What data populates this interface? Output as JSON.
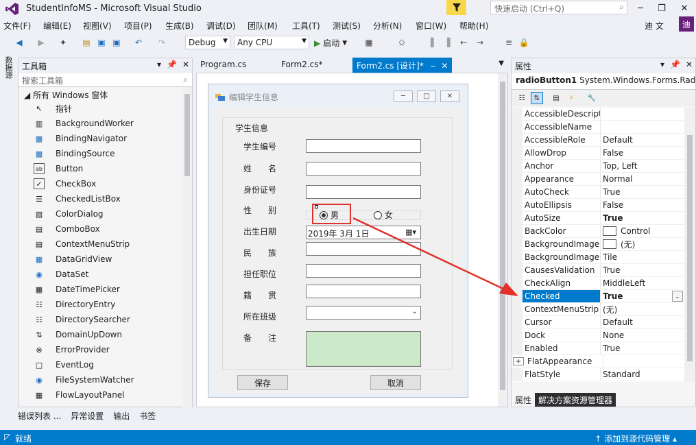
{
  "title": "StudentInfoMS - Microsoft Visual Studio",
  "quick_launch_placeholder": "快速启动 (Ctrl+Q)",
  "menu": [
    "文件(F)",
    "编辑(E)",
    "视图(V)",
    "项目(P)",
    "生成(B)",
    "调试(D)",
    "团队(M)",
    "工具(T)",
    "测试(S)",
    "分析(N)",
    "窗口(W)",
    "帮助(H)"
  ],
  "user": {
    "name": "迪 文",
    "initial": "迪"
  },
  "toolbar": {
    "config": "Debug",
    "platform": "Any CPU",
    "start": "启动"
  },
  "left_strip_tab": "数据源",
  "toolbox": {
    "title": "工具箱",
    "search_placeholder": "搜索工具箱",
    "group": "所有 Windows 窗体",
    "items": [
      {
        "label": "指针",
        "icon": "pointer-icon"
      },
      {
        "label": "BackgroundWorker",
        "icon": "backgroundworker-icon"
      },
      {
        "label": "BindingNavigator",
        "icon": "bindingnavigator-icon"
      },
      {
        "label": "BindingSource",
        "icon": "bindingsource-icon"
      },
      {
        "label": "Button",
        "icon": "button-icon"
      },
      {
        "label": "CheckBox",
        "icon": "checkbox-icon"
      },
      {
        "label": "CheckedListBox",
        "icon": "checkedlistbox-icon"
      },
      {
        "label": "ColorDialog",
        "icon": "colordialog-icon"
      },
      {
        "label": "ComboBox",
        "icon": "combobox-icon"
      },
      {
        "label": "ContextMenuStrip",
        "icon": "contextmenustrip-icon"
      },
      {
        "label": "DataGridView",
        "icon": "datagridview-icon"
      },
      {
        "label": "DataSet",
        "icon": "dataset-icon"
      },
      {
        "label": "DateTimePicker",
        "icon": "datetimepicker-icon"
      },
      {
        "label": "DirectoryEntry",
        "icon": "directoryentry-icon"
      },
      {
        "label": "DirectorySearcher",
        "icon": "directorysearcher-icon"
      },
      {
        "label": "DomainUpDown",
        "icon": "domainupdown-icon"
      },
      {
        "label": "ErrorProvider",
        "icon": "errorprovider-icon"
      },
      {
        "label": "EventLog",
        "icon": "eventlog-icon"
      },
      {
        "label": "FileSystemWatcher",
        "icon": "filesystemwatcher-icon"
      },
      {
        "label": "FlowLayoutPanel",
        "icon": "flowlayoutpanel-icon"
      }
    ]
  },
  "bottom_tabs": [
    "错误列表 ...",
    "异常设置",
    "输出",
    "书签"
  ],
  "status": {
    "left": "就绪",
    "right": "↑ 添加到源代码管理 ▴"
  },
  "doc_tabs": [
    {
      "label": "Program.cs",
      "active": false
    },
    {
      "label": "Form2.cs*",
      "active": false
    },
    {
      "label": "Form2.cs [设计]*",
      "active": true
    }
  ],
  "form": {
    "title": "编辑学生信息",
    "group_title": "学生信息",
    "labels": [
      "学生编号",
      "姓　　名",
      "身份证号",
      "性　　别",
      "出生日期",
      "民　　族",
      "担任职位",
      "籍　　贯",
      "所在班级",
      "备　　注"
    ],
    "radio_male": "男",
    "radio_female": "女",
    "date_value": "2019年  3月  1日",
    "save_label": "保存",
    "cancel_label": "取消"
  },
  "properties": {
    "title": "属性",
    "object_name": "radioButton1",
    "object_type": "System.Windows.Forms.RadioButton",
    "rows": [
      {
        "name": "AccessibleDescript",
        "value": "",
        "bold": false
      },
      {
        "name": "AccessibleName",
        "value": "",
        "bold": false
      },
      {
        "name": "AccessibleRole",
        "value": "Default",
        "bold": false
      },
      {
        "name": "AllowDrop",
        "value": "False",
        "bold": false
      },
      {
        "name": "Anchor",
        "value": "Top, Left",
        "bold": false
      },
      {
        "name": "Appearance",
        "value": "Normal",
        "bold": false
      },
      {
        "name": "AutoCheck",
        "value": "True",
        "bold": false
      },
      {
        "name": "AutoEllipsis",
        "value": "False",
        "bold": false
      },
      {
        "name": "AutoSize",
        "value": "True",
        "bold": true
      },
      {
        "name": "BackColor",
        "value": "Control",
        "bold": false,
        "swatch": "#ffffff"
      },
      {
        "name": "BackgroundImage",
        "value": "(无)",
        "bold": false,
        "swatch": "#ffffff"
      },
      {
        "name": "BackgroundImage",
        "value": "Tile",
        "bold": false
      },
      {
        "name": "CausesValidation",
        "value": "True",
        "bold": false
      },
      {
        "name": "CheckAlign",
        "value": "MiddleLeft",
        "bold": false
      },
      {
        "name": "Checked",
        "value": "True",
        "bold": true,
        "selected": true
      },
      {
        "name": "ContextMenuStrip",
        "value": "(无)",
        "bold": false
      },
      {
        "name": "Cursor",
        "value": "Default",
        "bold": false
      },
      {
        "name": "Dock",
        "value": "None",
        "bold": false
      },
      {
        "name": "Enabled",
        "value": "True",
        "bold": false
      },
      {
        "name": "FlatAppearance",
        "value": "",
        "bold": false,
        "expand": true
      },
      {
        "name": "FlatStyle",
        "value": "Standard",
        "bold": false
      }
    ],
    "tabs": [
      "属性",
      "解决方案资源管理器"
    ]
  },
  "colors": {
    "accent": "#007acc",
    "highlight": "#e0312a",
    "memo_bg": "#cbe8c8"
  }
}
